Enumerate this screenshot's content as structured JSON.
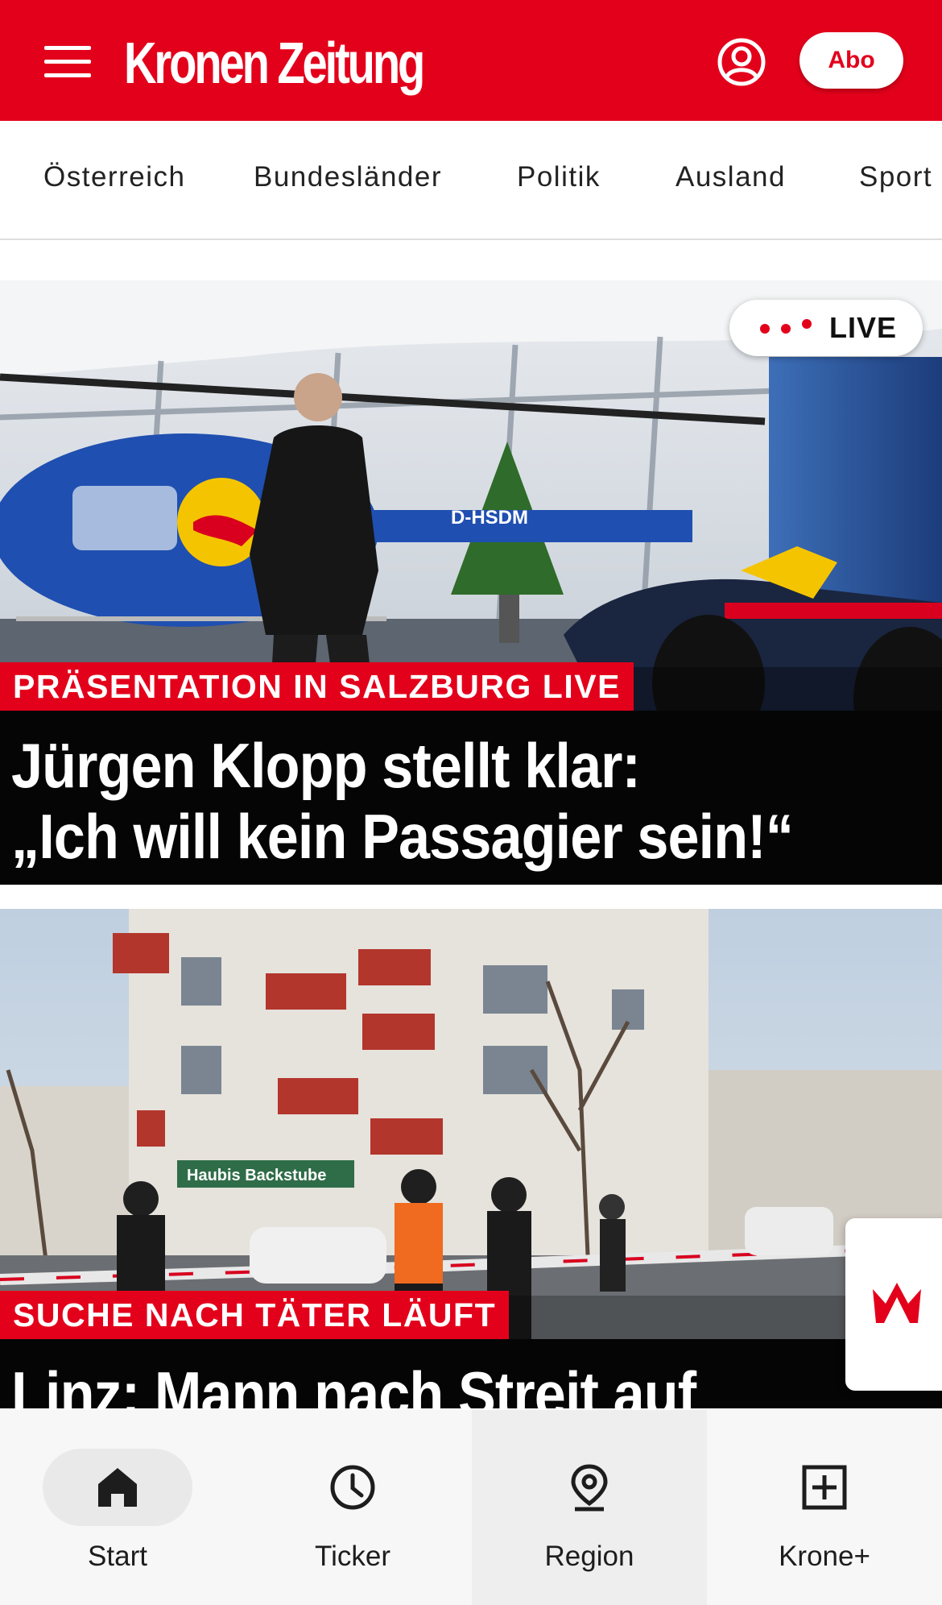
{
  "header": {
    "logo_text": "Kronen Zeitung",
    "abo_label": "Abo",
    "brand_color": "#e3001b",
    "menu_icon": "hamburger-menu-icon",
    "account_icon": "user-account-icon"
  },
  "categories": [
    "Österreich",
    "Bundesländer",
    "Politik",
    "Ausland",
    "Sport"
  ],
  "articles": [
    {
      "kicker": "PRÄSENTATION IN SALZBURG LIVE",
      "headline_line1": "Jürgen Klopp stellt klar:",
      "headline_line2": "„Ich will kein Passagier sein!“",
      "live_label": "LIVE",
      "image_text": "D-HSDM"
    },
    {
      "kicker": "SUCHE NACH TÄTER LÄUFT",
      "headline_line1": "Linz: Mann nach Streit auf",
      "image_text": "Haubis Backstube"
    }
  ],
  "side_widget": {
    "icon": "krone-crown-icon"
  },
  "bottom_nav": [
    {
      "label": "Start",
      "icon": "home-icon",
      "active": true
    },
    {
      "label": "Ticker",
      "icon": "clock-icon",
      "active": false
    },
    {
      "label": "Region",
      "icon": "location-pin-icon",
      "active": false
    },
    {
      "label": "Krone+",
      "icon": "plus-box-icon",
      "active": false
    }
  ]
}
